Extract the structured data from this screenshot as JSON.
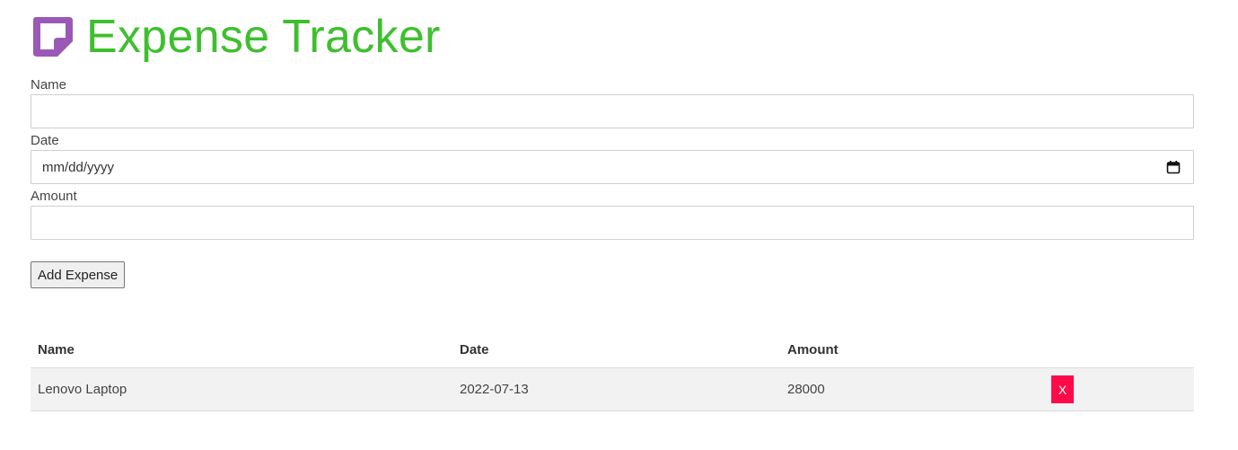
{
  "app": {
    "title": "Expense Tracker",
    "logo_icon": "sticky-note-icon",
    "title_color": "#3fbf2f",
    "logo_color": "#9b59b6"
  },
  "form": {
    "name_label": "Name",
    "name_value": "",
    "date_label": "Date",
    "date_placeholder": "mm/dd/yyyy",
    "date_icon": "calendar-icon",
    "amount_label": "Amount",
    "amount_value": "",
    "submit_label": "Add Expense"
  },
  "table": {
    "headers": [
      "Name",
      "Date",
      "Amount",
      ""
    ],
    "rows": [
      {
        "name": "Lenovo Laptop",
        "date": "2022-07-13",
        "amount": "28000",
        "delete_label": "X"
      }
    ],
    "delete_color": "#ff0a4a"
  }
}
